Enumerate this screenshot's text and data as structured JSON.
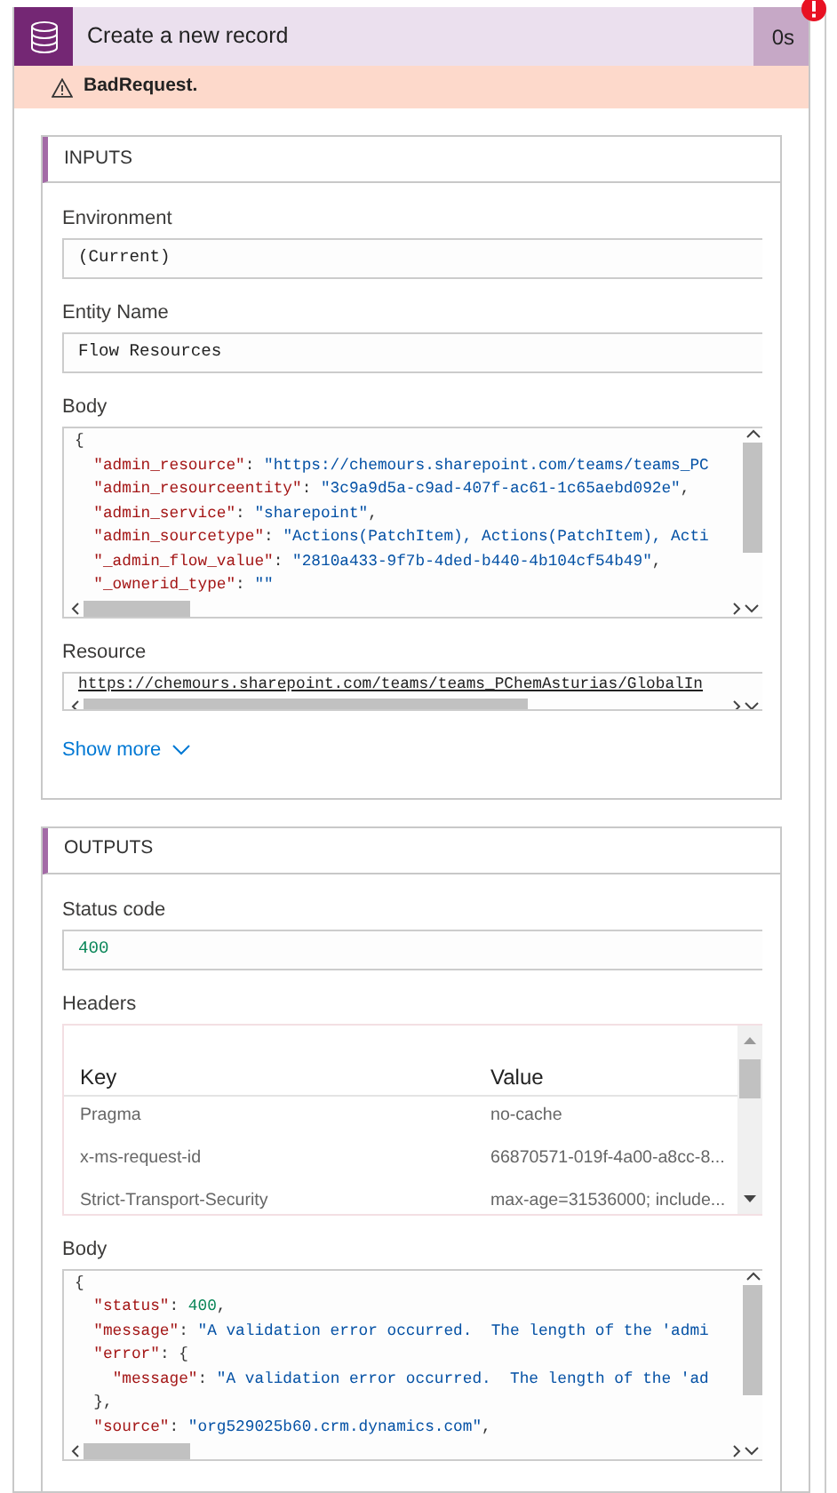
{
  "step": {
    "title": "Create a new record",
    "duration": "0s",
    "error": "BadRequest."
  },
  "inputs": {
    "title": "INPUTS",
    "fields": [
      {
        "label": "Environment",
        "kind": "text",
        "value": "(Current)"
      },
      {
        "label": "Entity Name",
        "kind": "text",
        "value": "Flow Resources"
      },
      {
        "label": "Body",
        "kind": "code",
        "lines": [
          "{",
          "  \"admin_resource\": \"https://chemours.sharepoint.com/teams/teams_PC",
          "  \"admin_resourceentity\": \"3c9a9d5a-c9ad-407f-ac61-1c65aebd092e\",",
          "  \"admin_service\": \"sharepoint\",",
          "  \"admin_sourcetype\": \"Actions(PatchItem), Actions(PatchItem), Acti",
          "  \"_admin_flow_value\": \"2810a433-9f7b-4ded-b440-4b104cf54b49\",",
          "  \"_ownerid_type\": \"\""
        ]
      },
      {
        "label": "Resource",
        "kind": "link",
        "value": "https://chemours.sharepoint.com/teams/teams_PChemAsturias/GlobalIn"
      }
    ],
    "show_more": "Show more"
  },
  "outputs": {
    "title": "OUTPUTS",
    "fields": [
      {
        "label": "Status code",
        "kind": "number",
        "value": "400"
      },
      {
        "label": "Headers",
        "kind": "table",
        "columns": [
          "Key",
          "Value"
        ],
        "rows": [
          [
            "Pragma",
            "no-cache"
          ],
          [
            "x-ms-request-id",
            "66870571-019f-4a00-a8cc-8..."
          ],
          [
            "Strict-Transport-Security",
            "max-age=31536000; include..."
          ]
        ]
      },
      {
        "label": "Body",
        "kind": "code",
        "lines": [
          "{",
          "  \"status\": 400,",
          "  \"message\": \"A validation error occurred.  The length of the 'admi",
          "  \"error\": {",
          "    \"message\": \"A validation error occurred.  The length of the 'ad",
          "  },",
          "  \"source\": \"org529025b60.crm.dynamics.com\","
        ]
      }
    ]
  }
}
